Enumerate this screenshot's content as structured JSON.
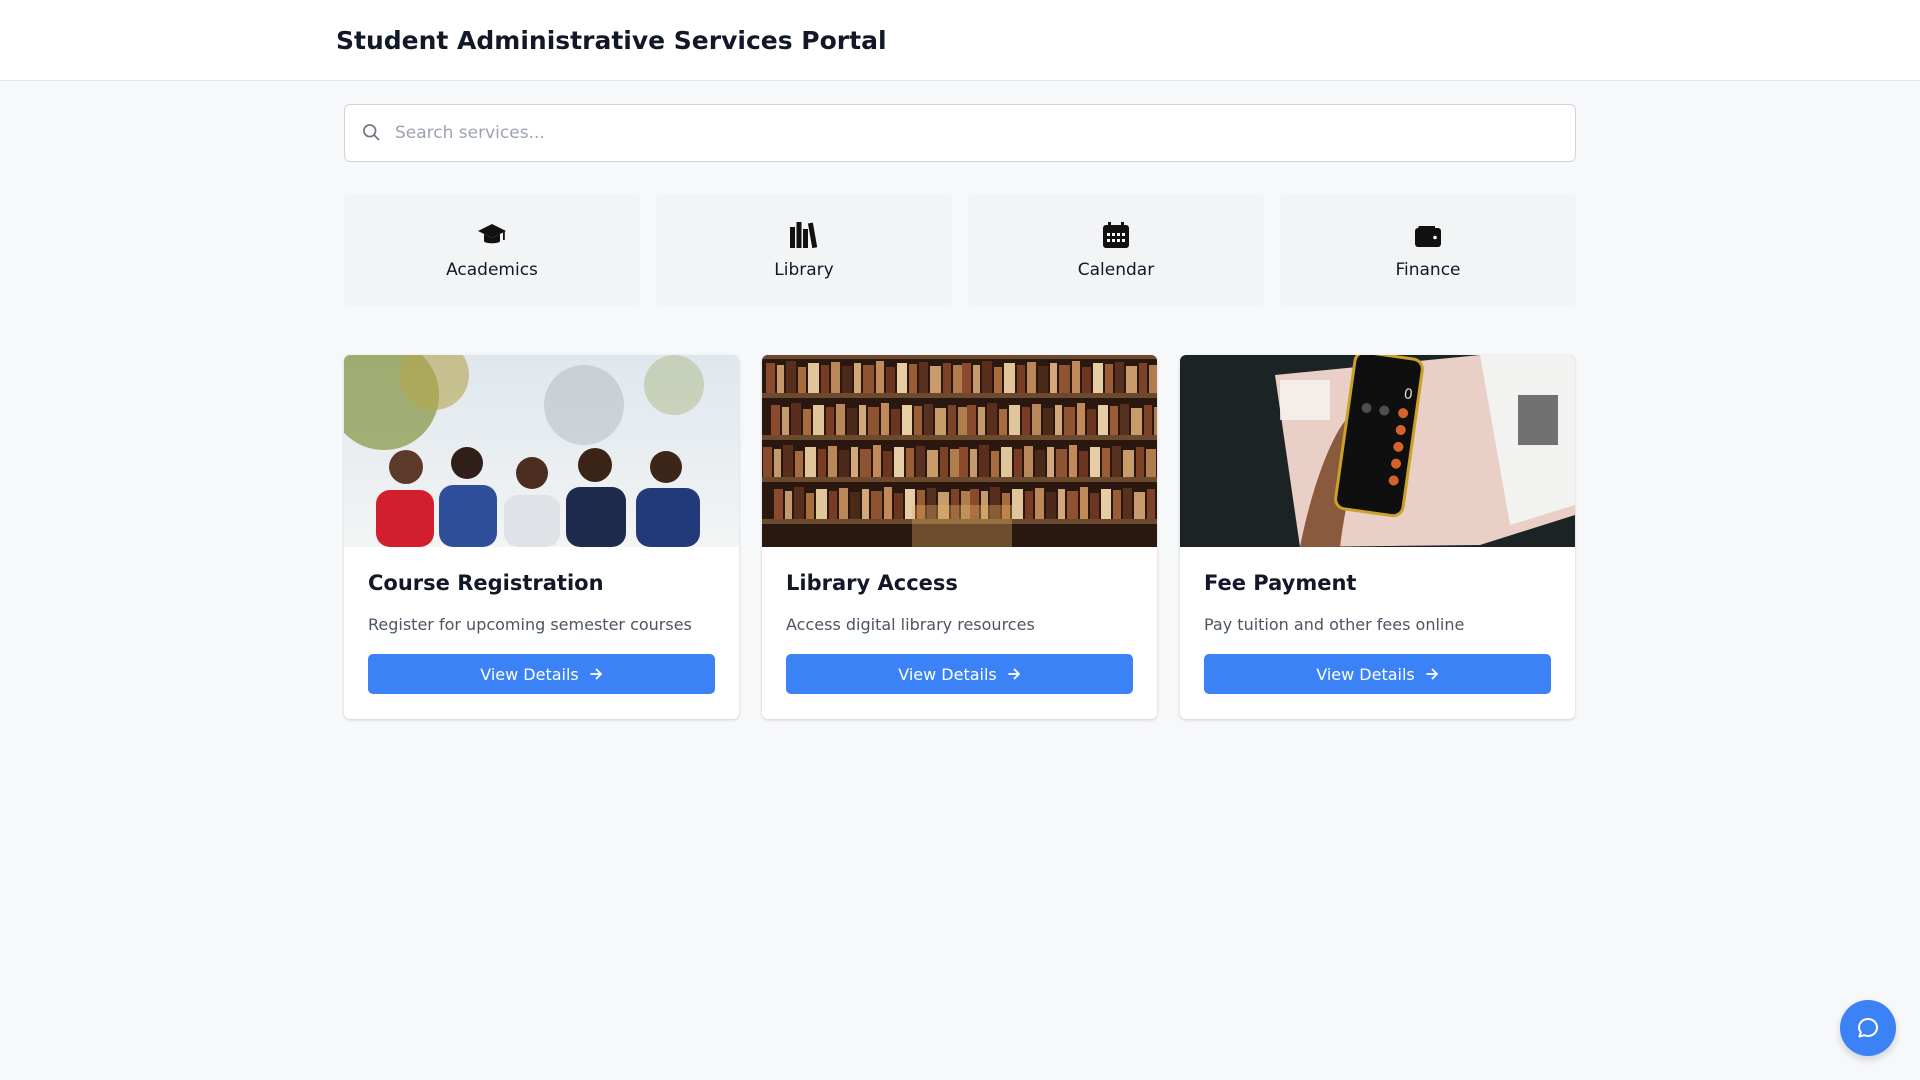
{
  "header": {
    "title": "Student Administrative Services Portal"
  },
  "search": {
    "placeholder": "Search services...",
    "value": ""
  },
  "quick_links": [
    {
      "label": "Academics",
      "icon": "graduation-cap-icon"
    },
    {
      "label": "Library",
      "icon": "books-icon"
    },
    {
      "label": "Calendar",
      "icon": "calendar-icon"
    },
    {
      "label": "Finance",
      "icon": "wallet-icon"
    }
  ],
  "services": [
    {
      "title": "Course Registration",
      "description": "Register for upcoming semester courses",
      "button": "View Details",
      "image": "students-group-photo"
    },
    {
      "title": "Library Access",
      "description": "Access digital library resources",
      "button": "View Details",
      "image": "bookshelf-photo"
    },
    {
      "title": "Fee Payment",
      "description": "Pay tuition and other fees online",
      "button": "View Details",
      "image": "calculator-phone-photo"
    }
  ],
  "colors": {
    "accent": "#3b82f6",
    "page_bg": "#f7f8fa",
    "tile_bg": "#f3f4f6"
  },
  "chat": {
    "icon": "chat-bubble-icon"
  }
}
